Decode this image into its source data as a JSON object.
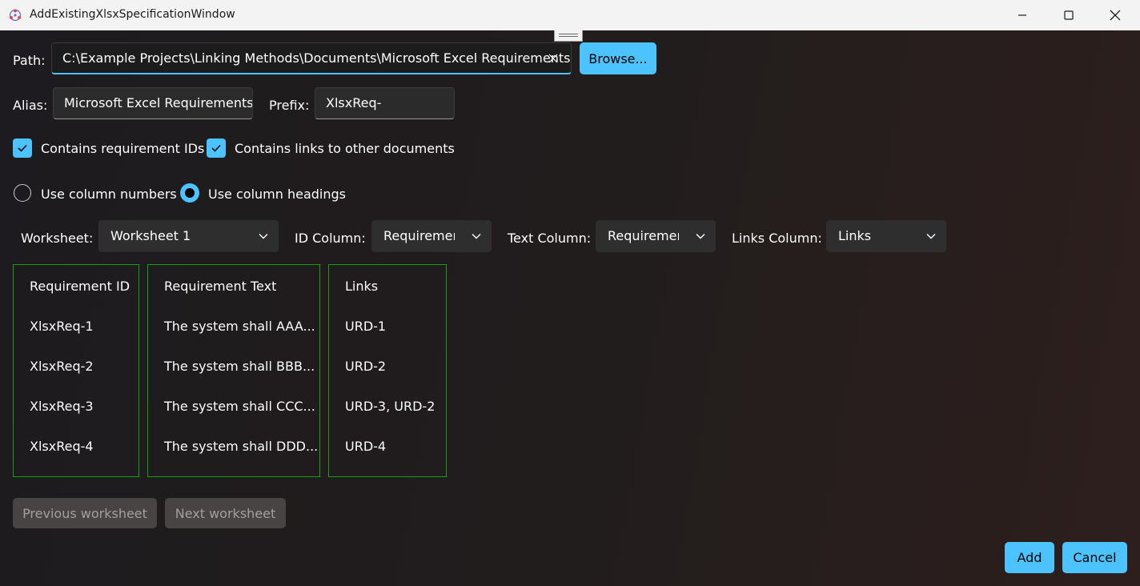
{
  "window": {
    "title": "AddExistingXlsxSpecificationWindow",
    "buttons": [
      "minimize",
      "maximize",
      "close"
    ]
  },
  "path": {
    "label": "Path:",
    "value": "C:\\Example Projects\\Linking Methods\\Documents\\Microsoft Excel Requirements.xlsx",
    "clear_icon": "close-icon",
    "browse_label": "Browse..."
  },
  "alias": {
    "label": "Alias:",
    "value": "Microsoft Excel Requirements"
  },
  "prefix": {
    "label": "Prefix:",
    "value": "XlsxReq-"
  },
  "options": {
    "contains_ids_label": "Contains requirement IDs",
    "contains_ids_checked": true,
    "contains_links_label": "Contains links to other documents",
    "contains_links_checked": true,
    "use_numbers_label": "Use column numbers",
    "use_headings_label": "Use column headings",
    "selected_mode": "headings"
  },
  "selectors": {
    "worksheet_label": "Worksheet:",
    "worksheet_value": "Worksheet 1",
    "id_column_label": "ID Column:",
    "id_column_value": "Requirement ID",
    "text_column_label": "Text Column:",
    "text_column_value": "Requirement Text",
    "links_column_label": "Links Column:",
    "links_column_value": "Links"
  },
  "table": {
    "columns": [
      {
        "header": "Requirement ID",
        "cells": [
          "XlsxReq-1",
          "XlsxReq-2",
          "XlsxReq-3",
          "XlsxReq-4"
        ]
      },
      {
        "header": "Requirement Text",
        "cells": [
          "The system shall AAA...",
          "The system shall BBB...",
          "The system shall CCC...",
          "The system shall DDD..."
        ]
      },
      {
        "header": "Links",
        "cells": [
          "URD-1",
          "URD-2",
          "URD-3, URD-2",
          "URD-4"
        ]
      }
    ],
    "border_color": "#13a10e"
  },
  "navigation": {
    "previous_label": "Previous worksheet",
    "next_label": "Next worksheet"
  },
  "footer": {
    "add_label": "Add",
    "cancel_label": "Cancel"
  },
  "colors": {
    "accent": "#4cc2ff",
    "background": "#1f1b1b",
    "titlebar": "#f3f3f3"
  }
}
